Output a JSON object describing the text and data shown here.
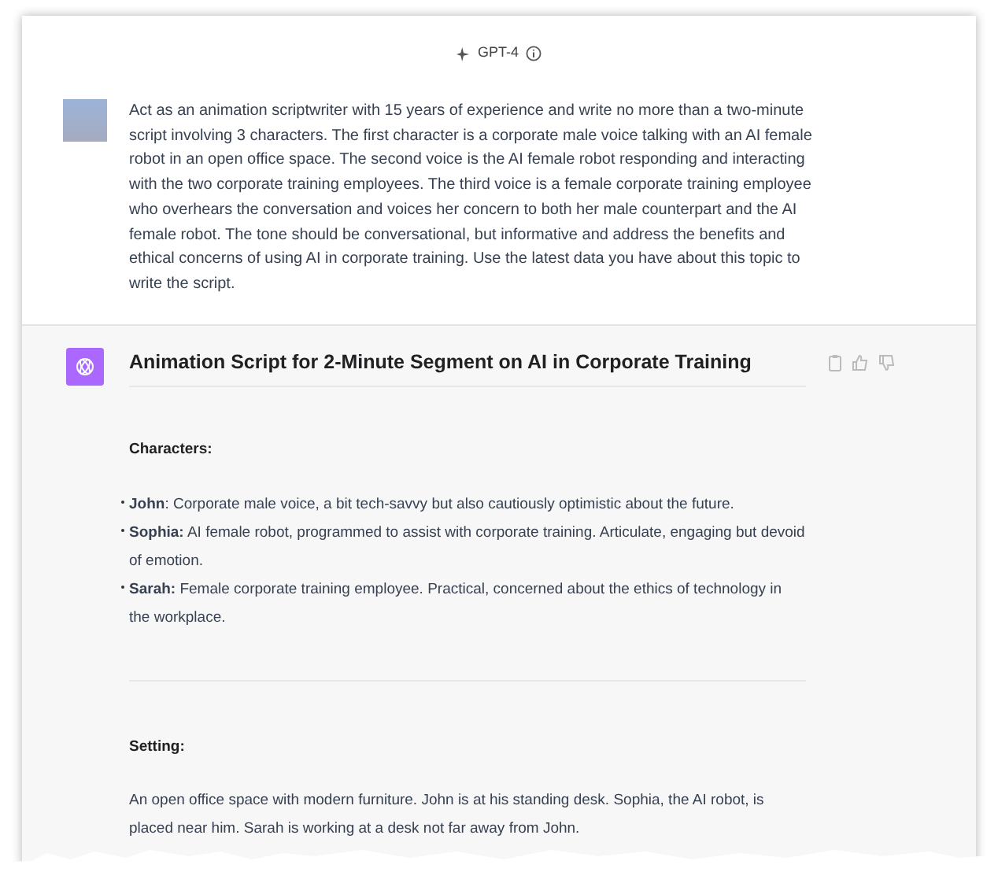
{
  "model_label": "GPT-4",
  "user_message": "Act as an animation scriptwriter with 15 years of experience and write no more than a two-minute script involving 3 characters. The first character is a corporate male voice talking with an AI female robot in an open office space. The second voice is the AI female robot responding and interacting with the two corporate training employees. The third voice is a female corporate training employee who overhears the conversation and voices her concern to both her male counterpart and the AI female robot. The tone should be conversational, but informative and address the benefits and ethical concerns of using AI in corporate training. Use the latest data you have about this topic to write the script.",
  "response": {
    "title": "Animation Script for 2-Minute Segment on AI in Corporate Training",
    "sections": [
      {
        "heading": "Characters:",
        "bullets": [
          "**John**: Corporate male voice, a bit tech-savvy but also cautiously optimistic about the future.",
          "**Sophia:** AI female robot, programmed to assist with corporate training. Articulate, engaging but devoid of emotion.",
          "**Sarah:** Female corporate training employee. Practical, concerned about the ethics of technology in the workplace."
        ]
      },
      {
        "heading": "Setting:",
        "paragraph": "An open office space with modern furniture. John is at his standing desk. Sophia, the AI robot, is placed near him. Sarah is working at a desk not far away from John."
      }
    ]
  }
}
